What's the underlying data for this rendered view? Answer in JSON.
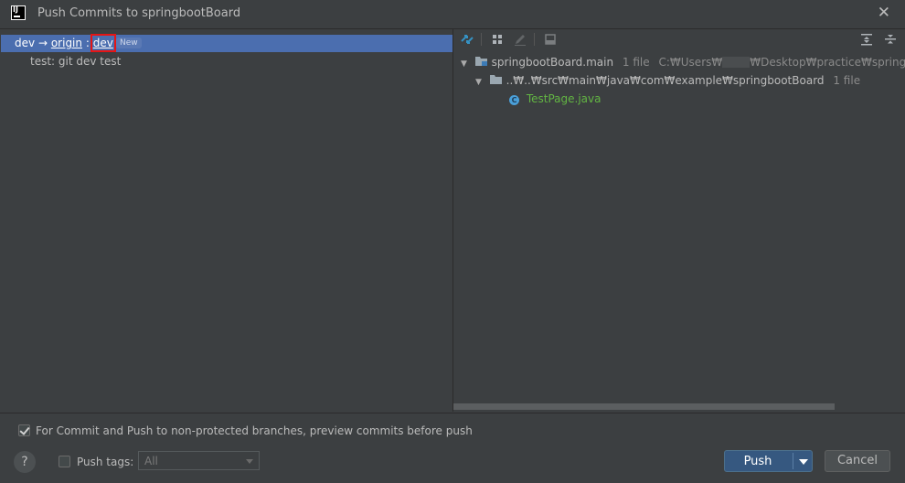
{
  "window": {
    "title": "Push Commits to springbootBoard",
    "app_icon_text": "IJ",
    "close_glyph": "✕"
  },
  "commits_pane": {
    "branch_row": {
      "local_branch": "dev",
      "arrow": "→",
      "remote": "origin",
      "separator": ":",
      "target_branch": "dev",
      "badge": "New"
    },
    "commits": [
      {
        "message": "test: git dev test"
      }
    ]
  },
  "changes_pane": {
    "toolbar": {
      "icons": [
        "compare-icon",
        "group-by-icon",
        "edit-icon",
        "show-diff-icon",
        "expand-all-icon",
        "collapse-all-icon"
      ]
    },
    "tree": {
      "module": {
        "name": "springbootBoard.main",
        "count": "1 file",
        "path": "C:₩Users₩"
      },
      "module_path_rest": "₩Desktop₩practice₩springbootBoard₩",
      "package": {
        "name": "..₩..₩src₩main₩java₩com₩example₩springbootBoard",
        "count": "1 file"
      },
      "file": {
        "name": "TestPage.java",
        "icon_letter": "C"
      }
    }
  },
  "options": {
    "preview_checkbox_label": "For Commit and Push to non-protected branches, preview commits before push",
    "preview_checked": true,
    "push_tags_label": "Push tags:",
    "push_tags_checked": false,
    "push_tags_value": "All"
  },
  "buttons": {
    "help": "?",
    "push": "Push",
    "cancel": "Cancel"
  },
  "colors": {
    "background": "#3c3f41",
    "selection": "#4b6eaf",
    "highlight_box": "#e51515",
    "new_file": "#62b543",
    "primary_button": "#365880"
  }
}
